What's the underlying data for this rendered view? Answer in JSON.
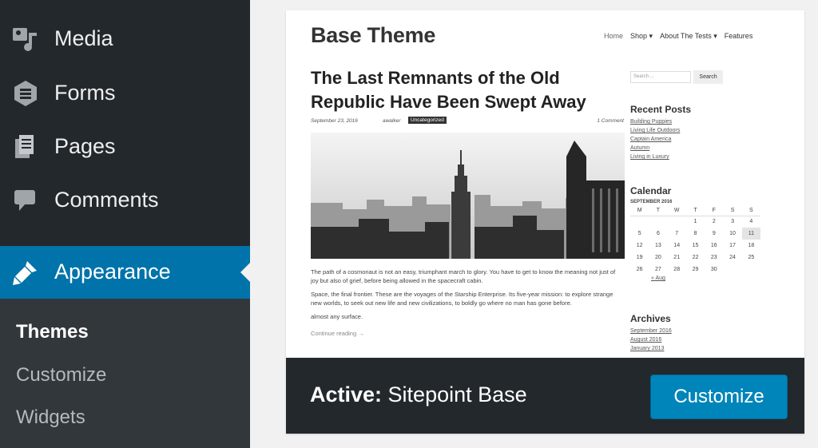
{
  "sidebar": {
    "items": [
      {
        "label": "Media",
        "icon": "media-icon"
      },
      {
        "label": "Forms",
        "icon": "forms-icon"
      },
      {
        "label": "Pages",
        "icon": "pages-icon"
      },
      {
        "label": "Comments",
        "icon": "comments-icon"
      },
      {
        "label": "Appearance",
        "icon": "appearance-brush-icon"
      }
    ],
    "submenu": [
      {
        "label": "Themes"
      },
      {
        "label": "Customize"
      },
      {
        "label": "Widgets"
      }
    ]
  },
  "theme_card": {
    "active_prefix": "Active:",
    "theme_name": "Sitepoint Base",
    "customize_label": "Customize"
  },
  "preview": {
    "site_title": "Base Theme",
    "nav": [
      "Home",
      "Shop ▾",
      "About The Tests ▾",
      "Features"
    ],
    "post_title": "The Last Remnants of the Old Republic Have Been Swept Away",
    "meta": {
      "date": "September 23, 2016",
      "author": "awalker",
      "category": "Uncategorized",
      "comments": "1 Comment"
    },
    "paragraphs": [
      "The path of a cosmonaut is not an easy, triumphant march to glory. You have to get to know the meaning not just of joy but also of grief, before being allowed in the spacecraft cabin.",
      "Space, the final frontier. These are the voyages of the Starship Enterprise. Its five-year mission: to explore strange new worlds, to seek out new life and new civilizations, to boldly go where no man has gone before.",
      "almost any surface."
    ],
    "continue": "Continue reading →",
    "search_placeholder": "Search ...",
    "search_button": "Search",
    "recent_posts_title": "Recent Posts",
    "recent_posts": [
      "Building Puppies",
      "Living Life Outdoors",
      "Captain America",
      "Autumn",
      "Living in Luxury"
    ],
    "calendar_title": "Calendar",
    "calendar_caption": "SEPTEMBER 2016",
    "calendar_days": [
      "M",
      "T",
      "W",
      "T",
      "F",
      "S",
      "S"
    ],
    "calendar_weeks": [
      [
        "",
        "",
        "",
        "1",
        "2",
        "3",
        "4"
      ],
      [
        "5",
        "6",
        "7",
        "8",
        "9",
        "10",
        "11"
      ],
      [
        "12",
        "13",
        "14",
        "15",
        "16",
        "17",
        "18"
      ],
      [
        "19",
        "20",
        "21",
        "22",
        "23",
        "24",
        "25"
      ],
      [
        "26",
        "27",
        "28",
        "29",
        "30",
        "",
        ""
      ]
    ],
    "calendar_today": "11",
    "calendar_prev": "« Aug",
    "archives_title": "Archives",
    "archives": [
      "September 2016",
      "August 2016",
      "January 2013"
    ]
  },
  "colors": {
    "sidebar_bg": "#23282d",
    "active_blue": "#0073aa",
    "button_blue": "#0085ba"
  }
}
